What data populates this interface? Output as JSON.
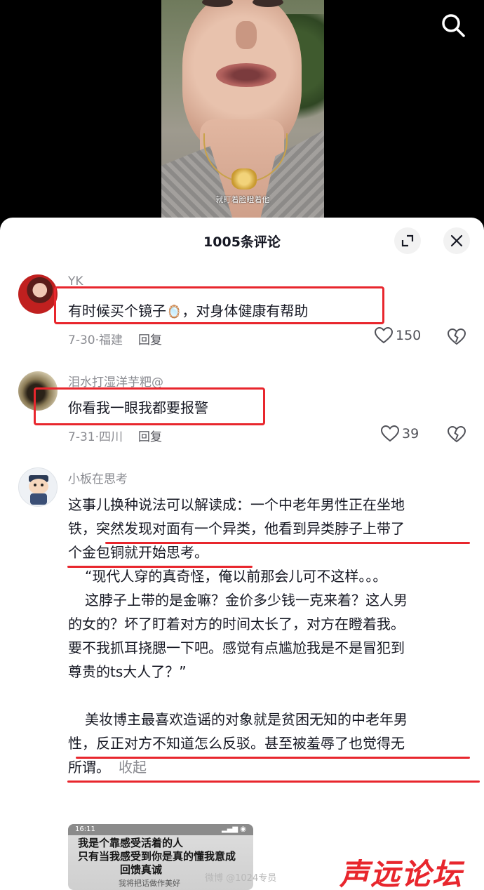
{
  "video": {
    "caption": "就盯着脸瞪着他"
  },
  "header": {
    "title": "1005条评论"
  },
  "comments": [
    {
      "username": "YK",
      "text": "有时候买个镜子",
      "emoji": "🪞",
      "text_after": "，对身体健康有帮助",
      "date": "7-30",
      "location": "福建",
      "reply_label": "回复",
      "likes": "150"
    },
    {
      "username": "泪水打湿洋芋粑@",
      "text": "你看我一眼我都要报警",
      "date": "7-31",
      "location": "四川",
      "reply_label": "回复",
      "likes": "39"
    },
    {
      "username": "小板在思考",
      "lines": [
        "这事儿换种说法可以解读成：一个中老年男性正在坐地",
        "铁，突然发现对面有一个异类，他看到异类脖子上带了",
        "个金包铜就开始思考。",
        "“现代人穿的真奇怪，俺以前那会儿可不这样。。。",
        "这脖子上带的是金嘛？金价多少钱一克来着？这人男",
        "的女的？坏了盯着对方的时间太长了，对方在瞪着我。",
        "要不我抓耳挠腮一下吧。感觉有点尴尬我是不是冒犯到",
        "尊贵的ts大人了？”",
        "美妆博主最喜欢造谣的对象就是贫困无知的中老年男",
        "性，反正对方不知道怎么反驳。甚至被羞辱了也觉得无",
        "所谓。"
      ],
      "collapse_label": "收起"
    }
  ],
  "thumbnail": {
    "status_time": "16:11",
    "lines": [
      "我是个靠感受活着的人",
      "只有当我感受到你是真的懂我意成",
      "回馈真诚"
    ],
    "caption": "我将把话做作美好"
  },
  "watermark": {
    "logo": "声远论坛",
    "user": "微博 @1024专员"
  },
  "colors": {
    "annotation_red": "#e8262d",
    "text_primary": "#161823",
    "text_secondary": "#8a8b91"
  }
}
